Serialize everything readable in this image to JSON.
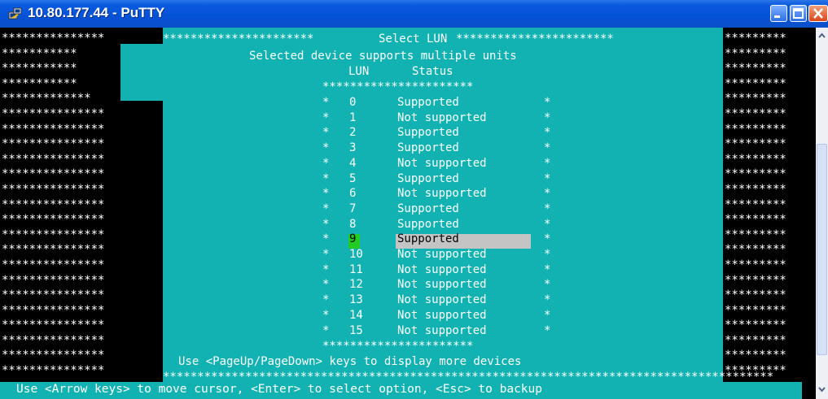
{
  "window": {
    "title": "10.80.177.44 - PuTTY"
  },
  "dialog": {
    "header": "Select LUN",
    "subtitle": "Selected device supports multiple units",
    "col_lun": "LUN",
    "col_status": "Status",
    "rows": [
      {
        "lun": "0",
        "status": "Supported"
      },
      {
        "lun": "1",
        "status": "Not supported"
      },
      {
        "lun": "2",
        "status": "Supported"
      },
      {
        "lun": "3",
        "status": "Supported"
      },
      {
        "lun": "4",
        "status": "Not supported"
      },
      {
        "lun": "5",
        "status": "Supported"
      },
      {
        "lun": "6",
        "status": "Not supported"
      },
      {
        "lun": "7",
        "status": "Supported"
      },
      {
        "lun": "8",
        "status": "Supported"
      },
      {
        "lun": "9",
        "status": "Supported"
      },
      {
        "lun": "10",
        "status": "Not supported"
      },
      {
        "lun": "11",
        "status": "Not supported"
      },
      {
        "lun": "12",
        "status": "Not supported"
      },
      {
        "lun": "13",
        "status": "Not supported"
      },
      {
        "lun": "14",
        "status": "Not supported"
      },
      {
        "lun": "15",
        "status": "Not supported"
      }
    ],
    "selected_lun": "9",
    "paging_hint": "Use <PageUp/PageDown> keys to display more devices"
  },
  "footer": {
    "hint": "Use <Arrow keys> to move cursor, <Enter> to select option, <Esc> to backup"
  },
  "colors": {
    "dialog_bg": "#12b2b2",
    "selection": "#c4c4c4",
    "cursor": "#22cc22",
    "titlebar": "#0552d6"
  }
}
